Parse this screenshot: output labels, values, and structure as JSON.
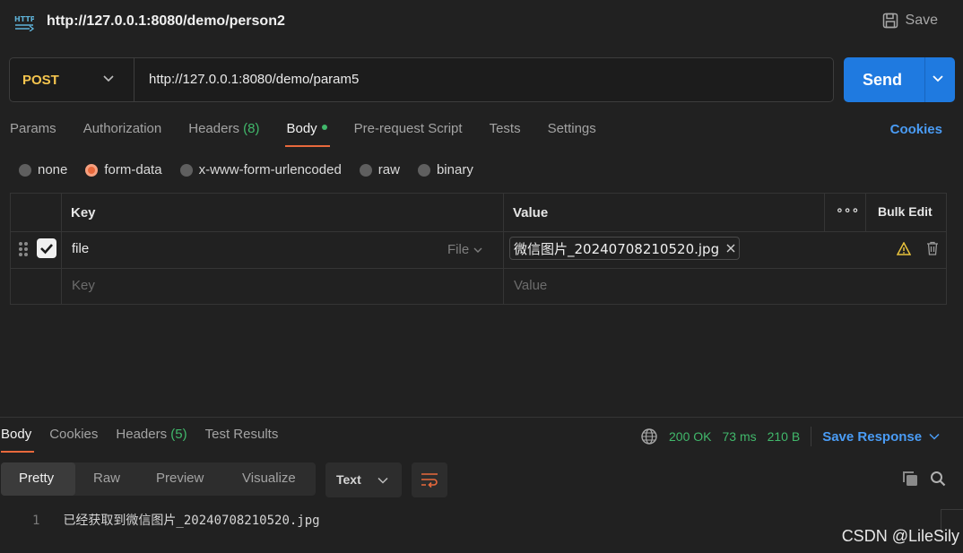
{
  "header": {
    "title": "http://127.0.0.1:8080/demo/person2",
    "save_label": "Save",
    "http_icon_text": "HTTP"
  },
  "request": {
    "method": "POST",
    "url": "http://127.0.0.1:8080/demo/param5",
    "send_label": "Send"
  },
  "tabs": {
    "params": "Params",
    "authorization": "Authorization",
    "headers": "Headers",
    "headers_count": "(8)",
    "body": "Body",
    "pre_request": "Pre-request Script",
    "tests": "Tests",
    "settings": "Settings",
    "cookies": "Cookies"
  },
  "body_types": [
    "none",
    "form-data",
    "x-www-form-urlencoded",
    "raw",
    "binary"
  ],
  "body_type_selected": "form-data",
  "table": {
    "key_header": "Key",
    "value_header": "Value",
    "more": "∘∘∘",
    "bulk_edit": "Bulk Edit",
    "row_key": "file",
    "row_type": "File",
    "row_value": "微信图片_20240708210520.jpg",
    "key_placeholder": "Key",
    "value_placeholder": "Value"
  },
  "response": {
    "tabs": {
      "body": "Body",
      "cookies": "Cookies",
      "headers": "Headers",
      "headers_count": "(5)",
      "test_results": "Test Results"
    },
    "status": "200 OK",
    "time": "73 ms",
    "size": "210 B",
    "save_response": "Save Response",
    "views": [
      "Pretty",
      "Raw",
      "Preview",
      "Visualize"
    ],
    "format": "Text",
    "line_number": "1",
    "body_text": "已经获取到微信图片_20240708210520.jpg"
  },
  "watermark": "CSDN @LileSily",
  "colors": {
    "accent": "#e8693c",
    "send": "#1f7ae0",
    "method": "#f5c54e",
    "success": "#41b86b",
    "link": "#4a9cf5"
  }
}
